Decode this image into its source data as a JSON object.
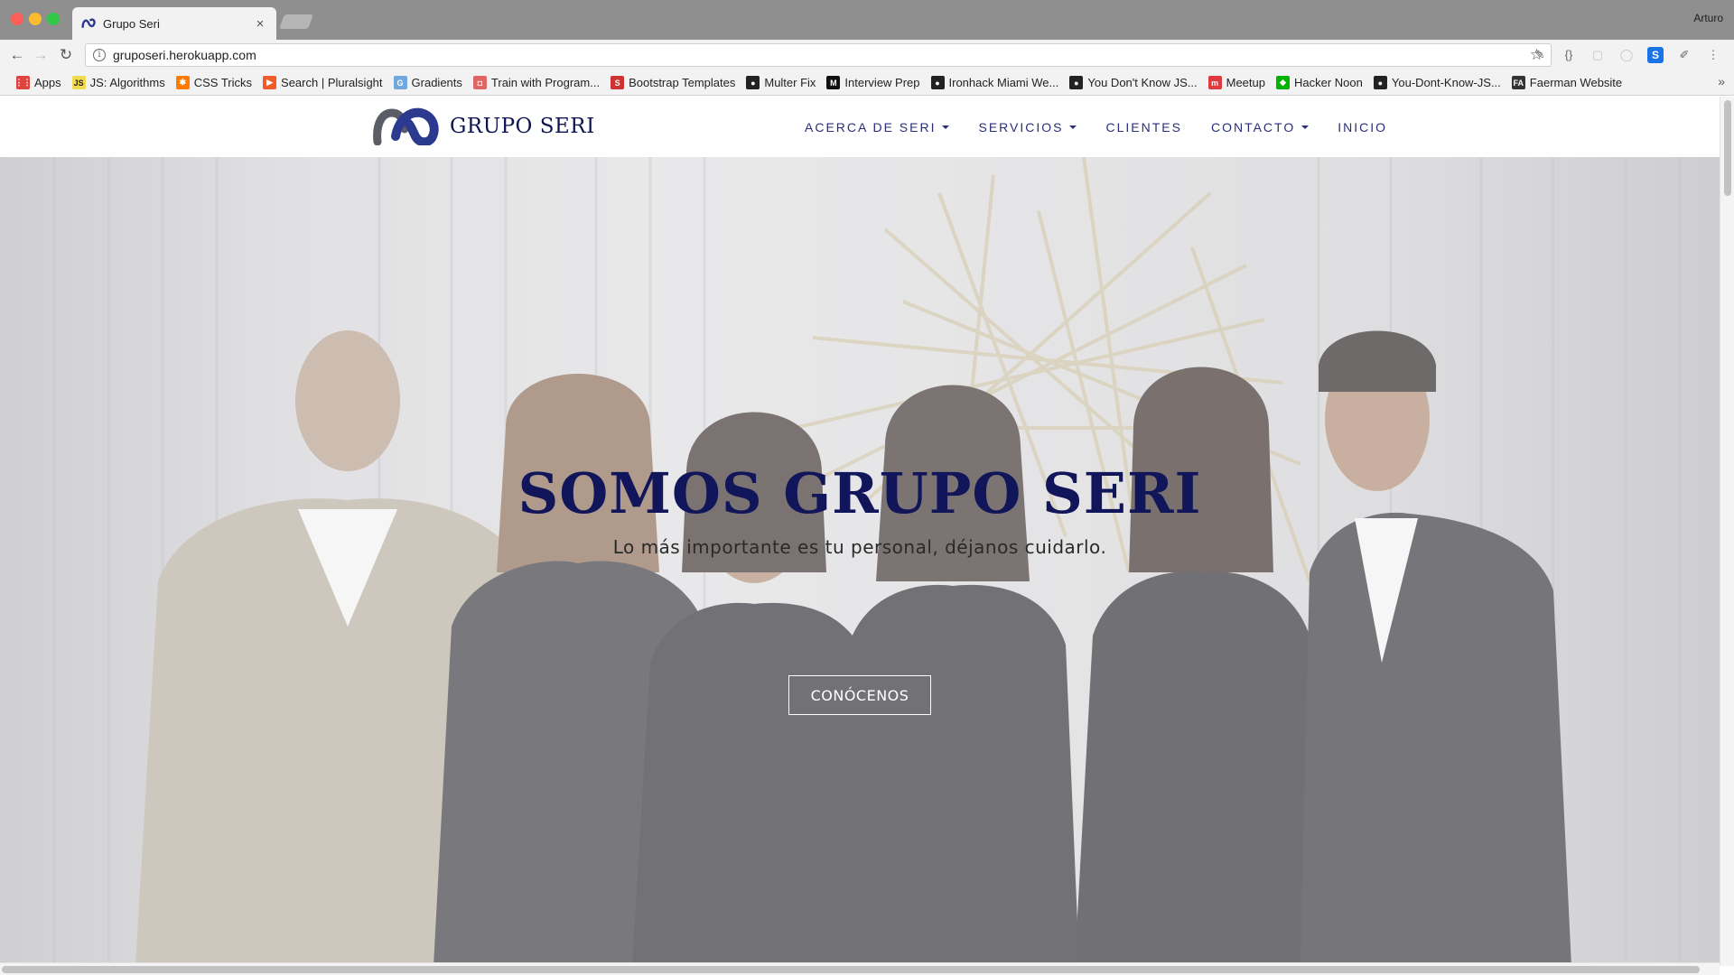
{
  "browser": {
    "tab_title": "Grupo Seri",
    "tab_close": "×",
    "profile_name": "Arturo",
    "url": "gruposeri.herokuapp.com",
    "bookmarks": [
      {
        "label": "Apps",
        "icon": "apps-grid-icon",
        "color": "#e0443e"
      },
      {
        "label": "JS: Algorithms",
        "icon": "js-icon",
        "color": "#f0db4f"
      },
      {
        "label": "CSS Tricks",
        "icon": "asterisk-icon",
        "color": "#ff7a00"
      },
      {
        "label": "Search | Pluralsight",
        "icon": "pluralsight-icon",
        "color": "#f15b2a"
      },
      {
        "label": "Gradients",
        "icon": "gradients-icon",
        "color": "#6fa8dc"
      },
      {
        "label": "Train with Program...",
        "icon": "train-icon",
        "color": "#e06666"
      },
      {
        "label": "Bootstrap Templates",
        "icon": "bootstrap-s-icon",
        "color": "#cc3333"
      },
      {
        "label": "Multer Fix",
        "icon": "github-icon",
        "color": "#222222"
      },
      {
        "label": "Interview Prep",
        "icon": "m-icon",
        "color": "#111111"
      },
      {
        "label": "Ironhack Miami We...",
        "icon": "github-icon",
        "color": "#222222"
      },
      {
        "label": "You Don't Know JS...",
        "icon": "github-icon",
        "color": "#222222"
      },
      {
        "label": "Meetup",
        "icon": "meetup-icon",
        "color": "#e0393e"
      },
      {
        "label": "Hacker Noon",
        "icon": "hackernoon-icon",
        "color": "#00b300"
      },
      {
        "label": "You-Dont-Know-JS...",
        "icon": "github-icon",
        "color": "#222222"
      },
      {
        "label": "Faerman Website",
        "icon": "fa-icon",
        "color": "#333333"
      }
    ],
    "bookmark_glyphs": {
      "Apps": "⋮⋮",
      "JS: Algorithms": "JS",
      "CSS Tricks": "✱",
      "Search | Pluralsight": "▶",
      "Gradients": "G",
      "Train with Program...": "◘",
      "Bootstrap Templates": "S",
      "Multer Fix": "●",
      "Interview Prep": "M",
      "Ironhack Miami We...": "●",
      "You Don't Know JS...": "●",
      "Meetup": "m",
      "Hacker Noon": "◆",
      "You-Dont-Know-JS...": "●",
      "Faerman Website": "FA"
    }
  },
  "site": {
    "logo_text": "GRUPO SERI",
    "nav": [
      {
        "label": "ACERCA DE SERI",
        "has_dropdown": true
      },
      {
        "label": "SERVICIOS",
        "has_dropdown": true
      },
      {
        "label": "CLIENTES",
        "has_dropdown": false
      },
      {
        "label": "CONTACTO",
        "has_dropdown": true
      },
      {
        "label": "INICIO",
        "has_dropdown": false
      }
    ],
    "hero": {
      "title": "SOMOS GRUPO SERI",
      "subtitle": "Lo más importante es tu personal, déjanos cuidarlo.",
      "button": "CONÓCENOS"
    }
  },
  "colors": {
    "brand_navy": "#11155a",
    "nav_text": "#2a2e7a",
    "logo_blue": "#2b3a8f",
    "logo_gray": "#5a5c66"
  }
}
